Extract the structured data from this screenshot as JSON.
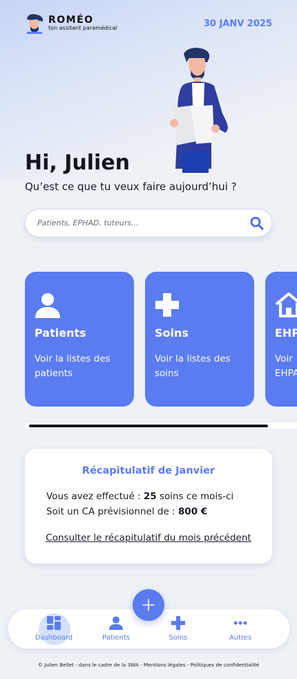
{
  "app": {
    "name": "ROMÉO",
    "tagline": "ton assitant paramédical",
    "date": "30 JANV 2025"
  },
  "greeting": {
    "title": "Hi, Julien",
    "subtitle": "Qu’est ce que tu veux faire aujourd’hui ?"
  },
  "search": {
    "placeholder": "Patients, EPHAD, tuteurs..."
  },
  "cards": [
    {
      "icon": "person-icon",
      "title": "Patients",
      "description": "Voir la listes des patients"
    },
    {
      "icon": "medical-cross-icon",
      "title": "Soins",
      "description": "Voir la listes des soins"
    },
    {
      "icon": "house-icon",
      "title": "EHPA",
      "description": "Voir\nEHPA"
    }
  ],
  "recap": {
    "title": "Récapitulatif de Janvier",
    "line1_prefix": "Vous avez effectué :",
    "line1_value": "25",
    "line1_suffix": "soins ce mois-ci",
    "line2_prefix": "Soit un CA prévisionnel de :",
    "line2_value": "800 €",
    "link": "Consulter le récapitulatif du mois précédent"
  },
  "nav": {
    "items": [
      {
        "label": "Dashboard",
        "icon": "dashboard-icon",
        "active": true
      },
      {
        "label": "Patients",
        "icon": "person-icon",
        "active": false
      },
      {
        "label": "Soins",
        "icon": "medical-cross-icon",
        "active": false
      },
      {
        "label": "Autres",
        "icon": "more-dots-icon",
        "active": false
      }
    ]
  },
  "footer": "© Julien Bellet - dans le cadre de la 3WA - Mentions légales - Politiques de confidentialité",
  "colors": {
    "accent": "#5b7cf0",
    "background": "#eef1f6",
    "text": "#1c1c28"
  }
}
